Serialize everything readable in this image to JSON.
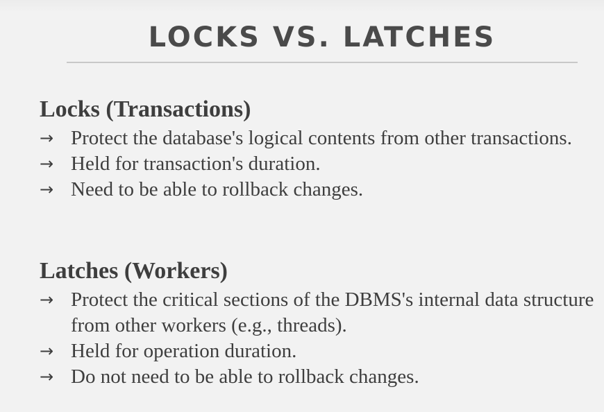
{
  "slide": {
    "title": "LOCKS VS. LATCHES",
    "sections": [
      {
        "heading": "Locks (Transactions)",
        "bullets": [
          "Protect the database's logical contents from other transactions.",
          "Held for transaction's duration.",
          "Need to be able to rollback changes."
        ]
      },
      {
        "heading": "Latches (Workers)",
        "bullets": [
          "Protect the critical sections of the DBMS's internal data structure from other workers (e.g., threads).",
          "Held for operation duration.",
          "Do not need to be able to rollback changes."
        ]
      }
    ],
    "bullet_glyph": "→"
  }
}
